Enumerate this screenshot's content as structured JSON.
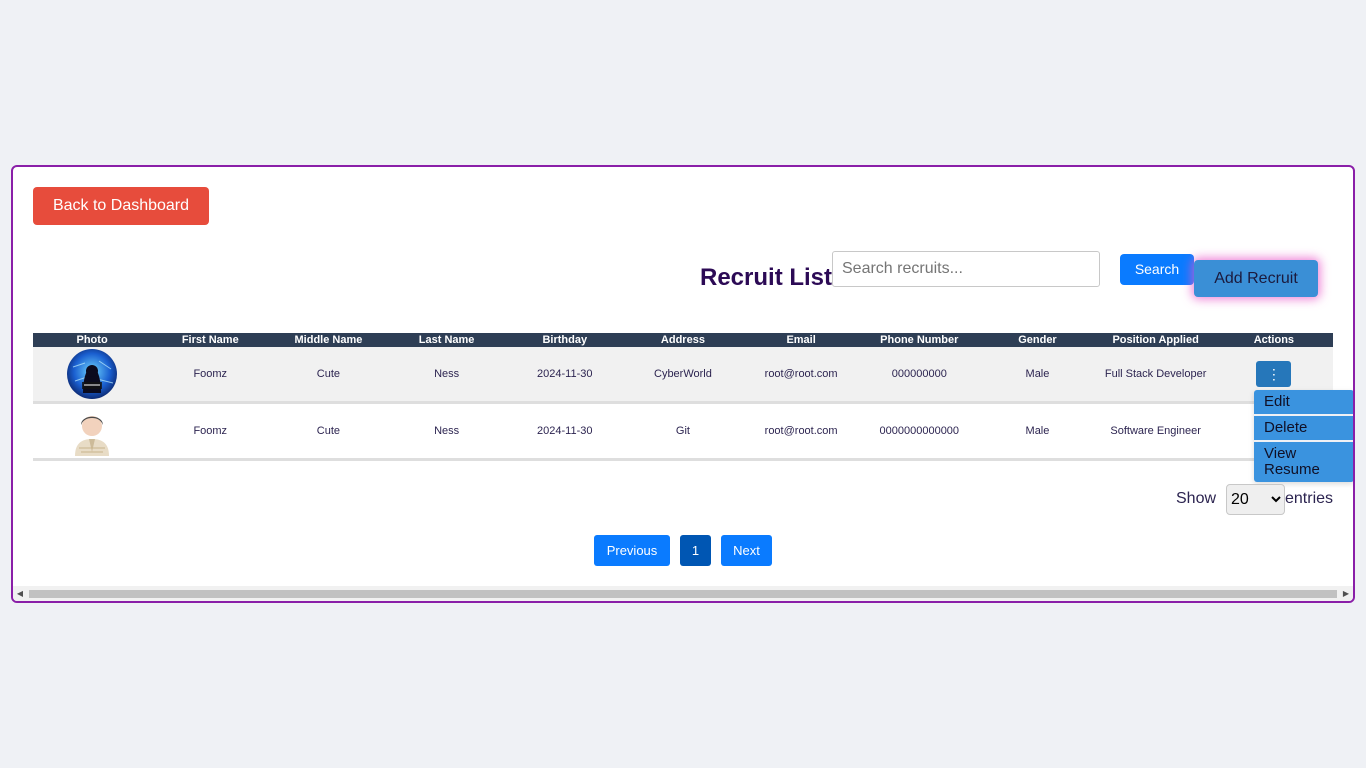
{
  "back_button": "Back to Dashboard",
  "page_title": "Recruit List",
  "search": {
    "placeholder": "Search recruits...",
    "button": "Search"
  },
  "add_button": "Add Recruit",
  "table": {
    "headers": [
      "Photo",
      "First Name",
      "Middle Name",
      "Last Name",
      "Birthday",
      "Address",
      "Email",
      "Phone Number",
      "Gender",
      "Position Applied",
      "Actions"
    ],
    "rows": [
      {
        "photo": "hacker-avatar",
        "first_name": "Foomz",
        "middle_name": "Cute",
        "last_name": "Ness",
        "birthday": "2024-11-30",
        "address": "CyberWorld",
        "email": "root@root.com",
        "phone": "000000000",
        "gender": "Male",
        "position": "Full Stack Developer",
        "action_icon": "⋮"
      },
      {
        "photo": "default-male-avatar",
        "first_name": "Foomz",
        "middle_name": "Cute",
        "last_name": "Ness",
        "birthday": "2024-11-30",
        "address": "Git",
        "email": "root@root.com",
        "phone": "0000000000000",
        "gender": "Male",
        "position": "Software Engineer",
        "action_icon": ""
      }
    ]
  },
  "action_menu": {
    "items": [
      "Edit",
      "Delete",
      "View Resume"
    ]
  },
  "pagination": {
    "show_label": "Show",
    "entries_value": "20",
    "entries_label": "entries",
    "previous": "Previous",
    "current_page": "1",
    "next": "Next"
  },
  "colors": {
    "back_button": "#e74c3c",
    "primary": "#0a7bff",
    "header": "#2e3e55",
    "border": "#8a1fa8"
  }
}
